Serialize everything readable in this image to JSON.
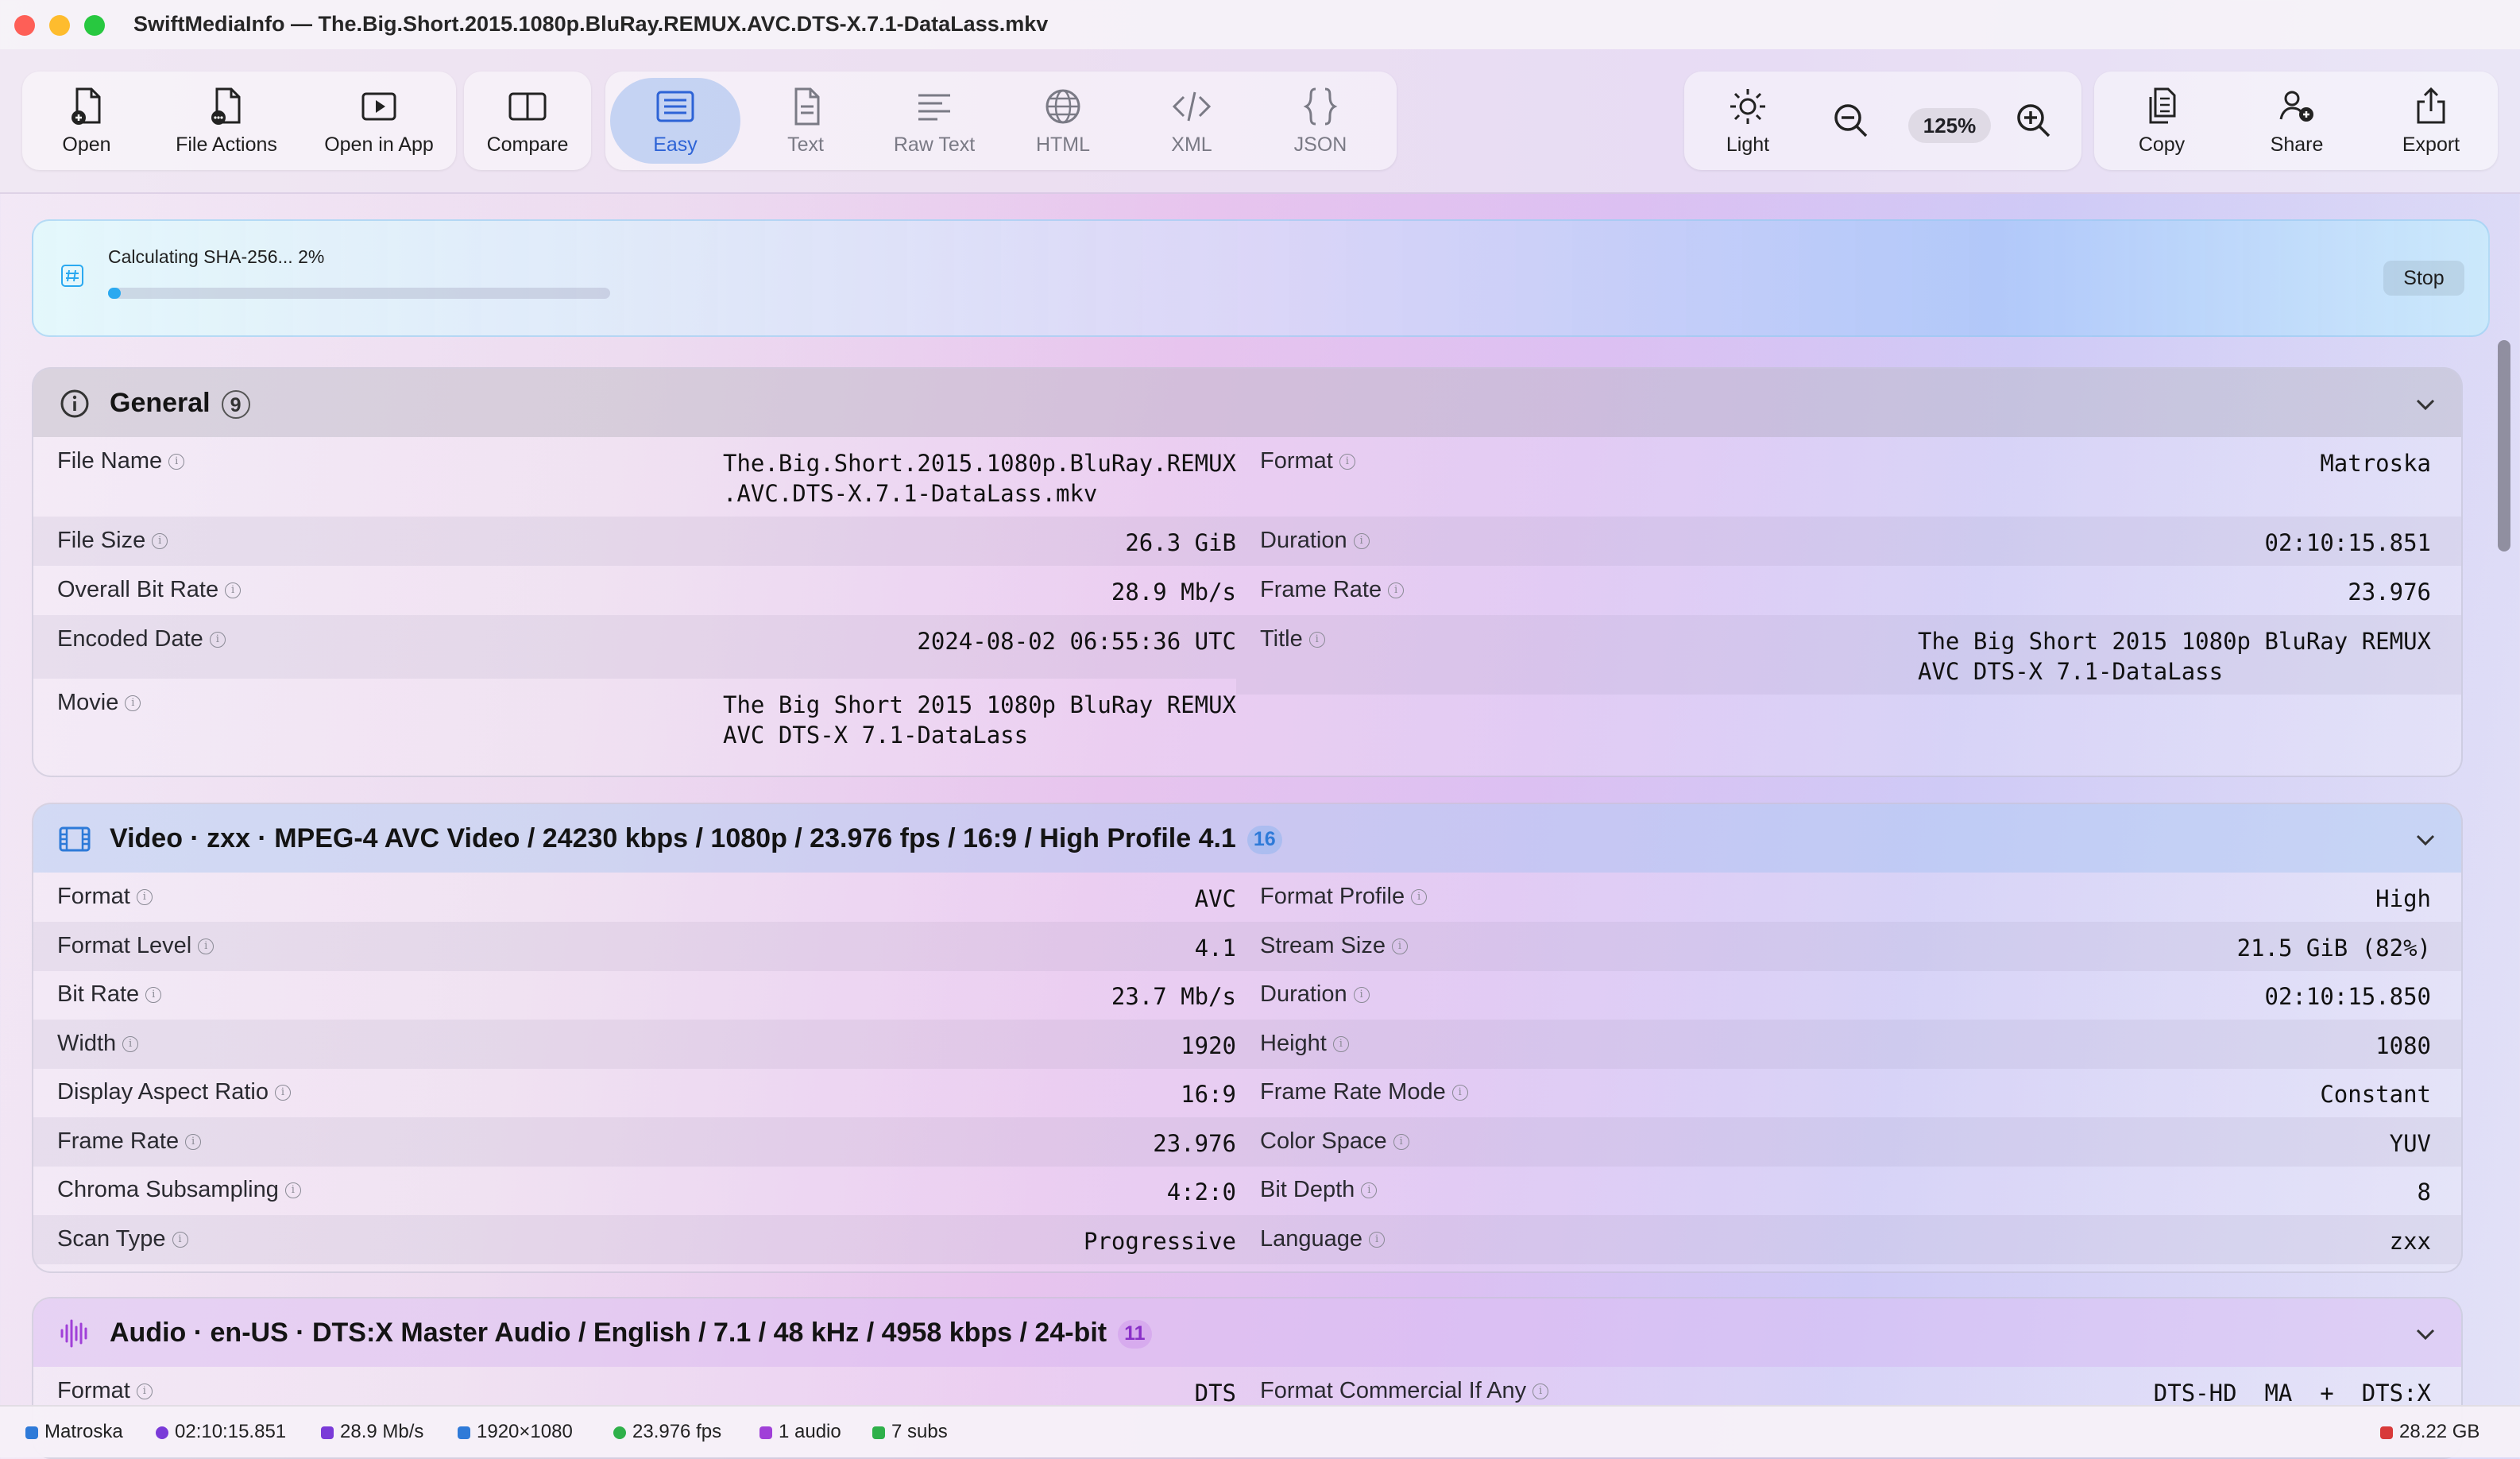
{
  "window": {
    "title": "SwiftMediaInfo — The.Big.Short.2015.1080p.BluRay.REMUX.AVC.DTS-X.7.1-DataLass.mkv"
  },
  "toolbar": {
    "file_group": [
      {
        "label": "Open",
        "icon": "open-file-icon"
      },
      {
        "label": "File Actions",
        "icon": "file-actions-icon"
      },
      {
        "label": "Open in App",
        "icon": "play-icon"
      }
    ],
    "compare": {
      "label": "Compare",
      "icon": "split-view-icon"
    },
    "views": [
      {
        "label": "Easy",
        "icon": "list-icon",
        "active": true
      },
      {
        "label": "Text",
        "icon": "document-icon"
      },
      {
        "label": "Raw Text",
        "icon": "text-lines-icon"
      },
      {
        "label": "HTML",
        "icon": "globe-icon"
      },
      {
        "label": "XML",
        "icon": "code-icon"
      },
      {
        "label": "JSON",
        "icon": "braces-icon"
      }
    ],
    "appearance": {
      "label": "Light",
      "icon": "sun-icon"
    },
    "zoom": {
      "value": "125%"
    },
    "actions": [
      {
        "label": "Copy",
        "icon": "copy-icon"
      },
      {
        "label": "Share",
        "icon": "share-icon"
      },
      {
        "label": "Export",
        "icon": "export-icon"
      }
    ]
  },
  "hash": {
    "text": "Calculating SHA-256... 2%",
    "progress": 0.02,
    "stop_label": "Stop",
    "icon": "hash-icon"
  },
  "general": {
    "title": "General",
    "count": "9",
    "icon": "info-icon",
    "left": [
      {
        "key": "File Name",
        "value": "The.Big.Short.2015.1080p.BluRay.REMUX\n.AVC.DTS-X.7.1-DataLass.mkv"
      },
      {
        "key": "File Size",
        "value": "26.3 GiB"
      },
      {
        "key": "Overall Bit Rate",
        "value": "28.9 Mb/s"
      },
      {
        "key": "Encoded  Date",
        "value": "2024-08-02 06:55:36 UTC"
      },
      {
        "key": "Movie",
        "value": "The Big Short 2015 1080p BluRay REMUX\nAVC DTS-X 7.1-DataLass"
      }
    ],
    "right": [
      {
        "key": "Format",
        "value": "Matroska"
      },
      {
        "key": "Duration",
        "value": "02:10:15.851"
      },
      {
        "key": "Frame Rate",
        "value": "23.976"
      },
      {
        "key": "Title",
        "value": "The Big Short 2015 1080p BluRay REMUX\nAVC DTS-X 7.1-DataLass"
      }
    ]
  },
  "video": {
    "title": "Video · zxx · MPEG-4 AVC Video / 24230 kbps / 1080p / 23.976 fps / 16:9 / High Profile 4.1",
    "count": "16",
    "icon": "film-icon",
    "left": [
      {
        "key": "Format",
        "value": "AVC"
      },
      {
        "key": "Format  Level",
        "value": "4.1"
      },
      {
        "key": "Bit Rate",
        "value": "23.7 Mb/s"
      },
      {
        "key": "Width",
        "value": "1920"
      },
      {
        "key": "Display Aspect Ratio",
        "value": "16:9"
      },
      {
        "key": "Frame Rate",
        "value": "23.976"
      },
      {
        "key": "Chroma Subsampling",
        "value": "4:2:0"
      },
      {
        "key": "Scan Type",
        "value": "Progressive"
      }
    ],
    "right": [
      {
        "key": "Format  Profile",
        "value": "High"
      },
      {
        "key": "Stream Size",
        "value": "21.5 GiB (82%)"
      },
      {
        "key": "Duration",
        "value": "02:10:15.850"
      },
      {
        "key": "Height",
        "value": "1080"
      },
      {
        "key": "Frame Rate  Mode",
        "value": "Constant"
      },
      {
        "key": "Color Space",
        "value": "YUV"
      },
      {
        "key": "Bit Depth",
        "value": "8"
      },
      {
        "key": "Language",
        "value": "zxx"
      }
    ]
  },
  "audio": {
    "title": "Audio · en-US · DTS:X Master Audio / English / 7.1 / 48 kHz / 4958 kbps / 24-bit",
    "count": "11",
    "icon": "waveform-icon",
    "left": [
      {
        "key": "Format",
        "value": "DTS"
      }
    ],
    "right": [
      {
        "key": "Format  Commercial  If Any",
        "value": "DTS-HD  MA  +  DTS:X"
      }
    ]
  },
  "status": {
    "items": [
      {
        "text": "Matroska",
        "color": "#2f7ad8",
        "icon": "file-icon"
      },
      {
        "text": "02:10:15.851",
        "color": "#7a3ad8",
        "icon": "clock-icon"
      },
      {
        "text": "28.9 Mb/s",
        "color": "#7a3ad8",
        "icon": "bolt-icon"
      },
      {
        "text": "1920×1080",
        "color": "#2f7ad8",
        "icon": "display-icon"
      },
      {
        "text": "23.976 fps",
        "color": "#2fb04a",
        "icon": "gauge-icon"
      },
      {
        "text": "1 audio",
        "color": "#a040d8",
        "icon": "waveform-icon"
      },
      {
        "text": "7 subs",
        "color": "#2fb04a",
        "icon": "captions-icon"
      }
    ],
    "disk": {
      "text": "28.22 GB",
      "color": "#d83a3a",
      "icon": "disk-icon"
    }
  }
}
